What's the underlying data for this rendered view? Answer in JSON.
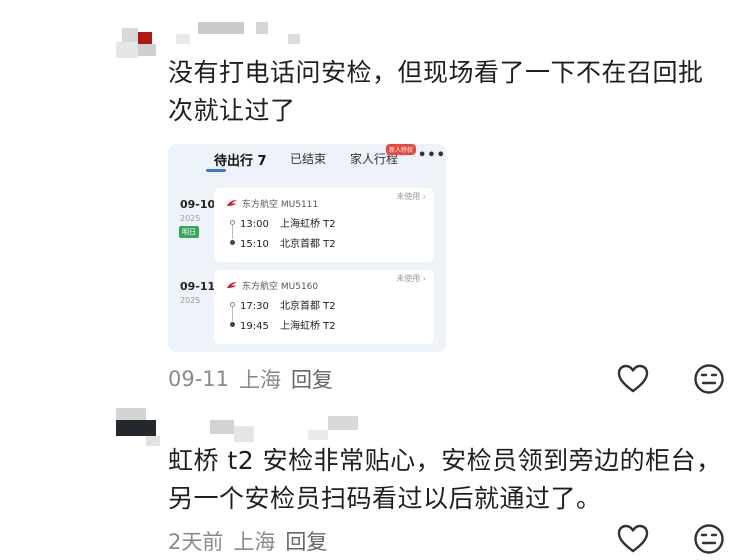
{
  "comments": [
    {
      "text": "没有打电话问安检，但现场看了一下不在召回批次就让过了",
      "date": "09-11",
      "location": "上海",
      "reply_label": "回复",
      "screenshot": {
        "tabs": [
          {
            "label": "待出行 7",
            "active": true
          },
          {
            "label": "已结束",
            "active": false
          },
          {
            "label": "家人行程",
            "active": false
          }
        ],
        "new_badge": "新人特权",
        "more": "•••",
        "trips": [
          {
            "date": "09-10",
            "year": "2025",
            "tag": "明日",
            "airline": "东方航空  MU5111",
            "status": "未使用 ›",
            "depart_time": "13:00",
            "depart_airport": "上海虹桥 T2",
            "arrive_time": "15:10",
            "arrive_airport": "北京首都 T2"
          },
          {
            "date": "09-11",
            "year": "2025",
            "tag": "",
            "airline": "东方航空  MU5160",
            "status": "未使用 ›",
            "depart_time": "17:30",
            "depart_airport": "北京首都 T2",
            "arrive_time": "19:45",
            "arrive_airport": "上海虹桥 T2"
          }
        ],
        "colors": {
          "accent": "#3a7bd5",
          "airline_red": "#c8102e",
          "tag_green": "#3aa55b"
        }
      }
    },
    {
      "text": "虹桥 t2 安检非常贴心，安检员领到旁边的柜台，另一个安检员扫码看过以后就通过了。",
      "date": "2天前",
      "location": "上海",
      "reply_label": "回复"
    }
  ],
  "icons": {
    "like": "heart-outline-icon",
    "react": "neutral-face-icon"
  }
}
